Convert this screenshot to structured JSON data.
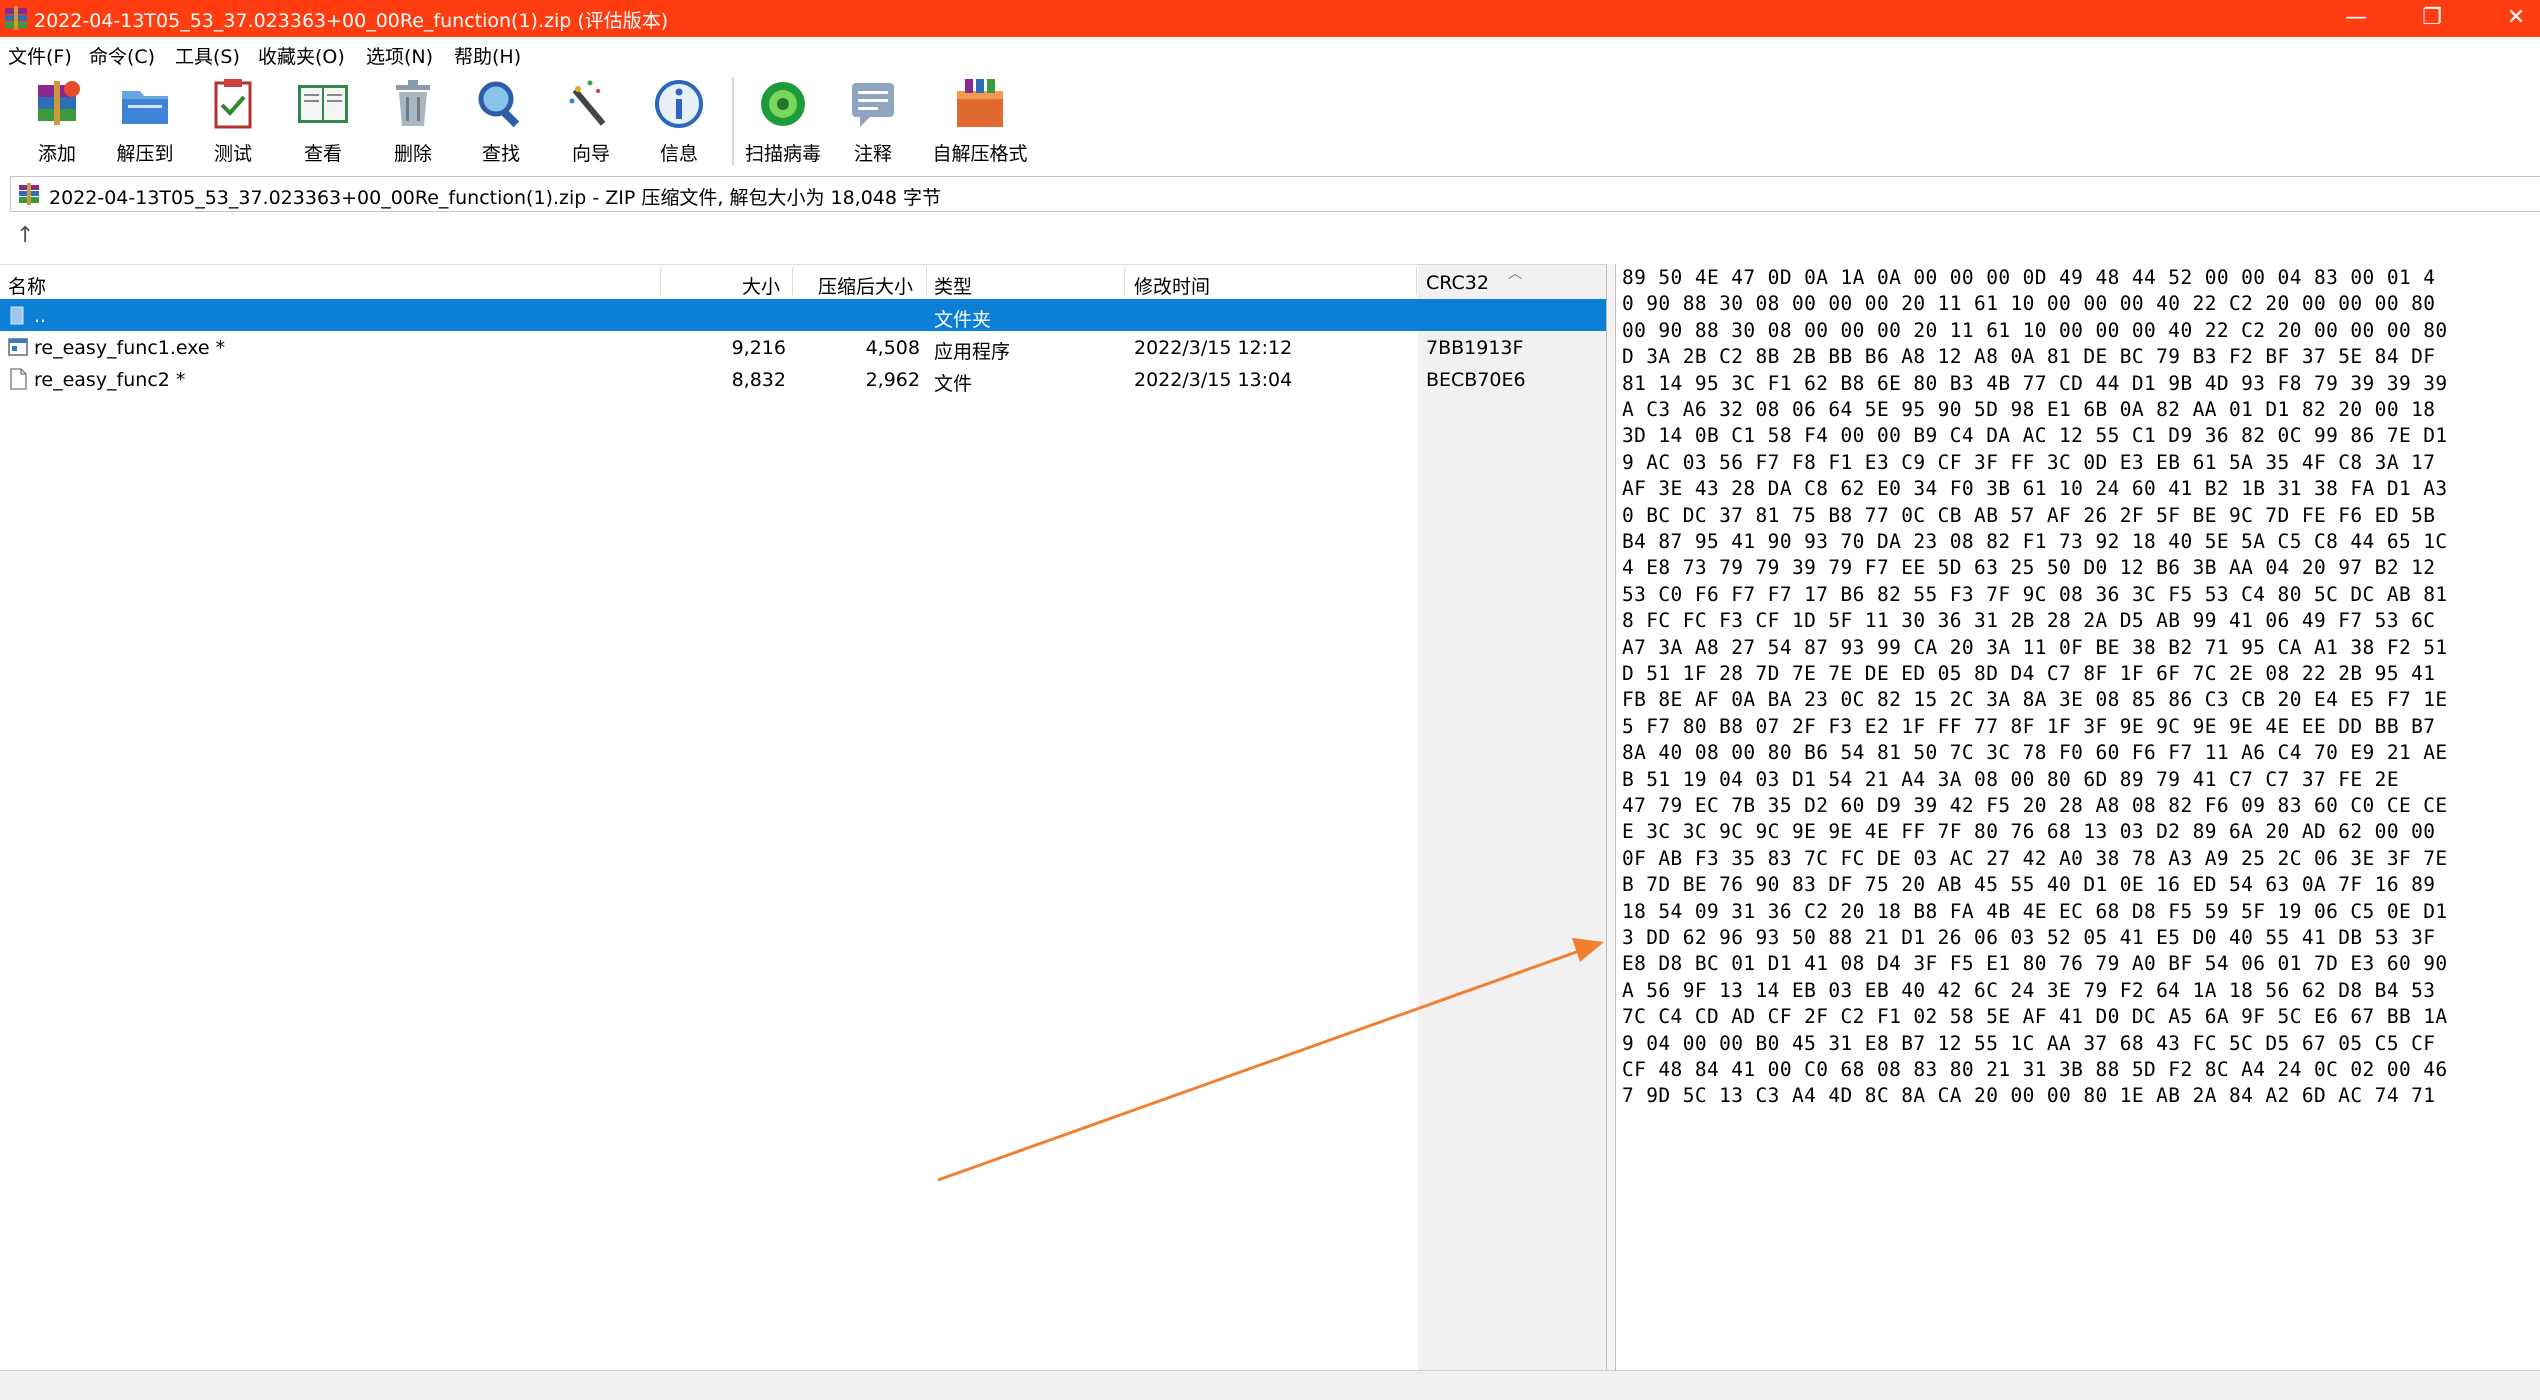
{
  "window": {
    "title": "2022-04-13T05_53_37.023363+00_00Re_function(1).zip (评估版本)",
    "minimize_glyph": "—",
    "maximize_glyph": "❐",
    "close_glyph": "✕"
  },
  "menu": [
    "文件(F)",
    "命令(C)",
    "工具(S)",
    "收藏夹(O)",
    "选项(N)",
    "帮助(H)"
  ],
  "toolbar": {
    "add": "添加",
    "extract_to": "解压到",
    "test": "测试",
    "view": "查看",
    "delete": "删除",
    "find": "查找",
    "wizard": "向导",
    "info": "信息",
    "virus_scan": "扫描病毒",
    "comment": "注释",
    "sfx": "自解压格式"
  },
  "path": {
    "text": "2022-04-13T05_53_37.023363+00_00Re_function(1).zip - ZIP 压缩文件, 解包大小为 18,048 字节",
    "up_glyph": "↑"
  },
  "columns": {
    "name": "名称",
    "size": "大小",
    "packed": "压缩后大小",
    "type": "类型",
    "modified": "修改时间",
    "crc": "CRC32"
  },
  "rows": [
    {
      "name": "..",
      "size": "",
      "packed": "",
      "type": "文件夹",
      "modified": "",
      "crc": ""
    },
    {
      "name": "re_easy_func1.exe *",
      "size": "9,216",
      "packed": "4,508",
      "type": "应用程序",
      "modified": "2022/3/15 12:12",
      "crc": "7BB1913F"
    },
    {
      "name": "re_easy_func2 *",
      "size": "8,832",
      "packed": "2,962",
      "type": "文件",
      "modified": "2022/3/15 13:04",
      "crc": "BECB70E6"
    }
  ],
  "hex_lines": [
    "89 50 4E 47 0D 0A 1A 0A 00 00 00 0D 49 48 44 52 00 00 04 83 00 01 4",
    "0 90 88 30 08 00 00 00 20 11 61 10 00 00 00 40 22 C2 20 00 00 00 80",
    "00 90 88 30 08 00 00 00 20 11 61 10 00 00 00 40 22 C2 20 00 00 00 80",
    "D 3A 2B C2 8B 2B BB B6 A8 12 A8 0A 81 DE BC 79 B3 F2 BF 37 5E 84 DF",
    "81 14 95 3C F1 62 B8 6E 80 B3 4B 77 CD 44 D1 9B 4D 93 F8 79 39 39 39",
    "A C3 A6 32 08 06 64 5E 95 90 5D 98 E1 6B 0A 82 AA 01 D1 82 20 00 18",
    "3D 14 0B C1 58 F4 00 00 B9 C4 DA AC 12 55 C1 D9 36 82 0C 99 86 7E D1",
    "9 AC 03 56 F7 F8 F1 E3 C9 CF 3F FF 3C 0D E3 EB 61 5A 35 4F C8 3A 17",
    "AF 3E 43 28 DA C8 62 E0 34 F0 3B 61 10 24 60 41 B2 1B 31 38 FA D1 A3",
    "0 BC DC 37 81 75 B8 77 0C CB AB 57 AF 26 2F 5F BE 9C 7D FE F6 ED 5B",
    "B4 87 95 41 90 93 70 DA 23 08 82 F1 73 92 18 40 5E 5A C5 C8 44 65 1C",
    "4 E8 73 79 79 39 79 F7 EE 5D 63 25 50 D0 12 B6 3B AA 04 20 97 B2 12",
    "53 C0 F6 F7 F7 17 B6 82 55 F3 7F 9C 08 36 3C F5 53 C4 80 5C DC AB 81",
    "8 FC FC F3 CF 1D 5F 11 30 36 31 2B 28 2A D5 AB 99 41 06 49 F7 53 6C",
    "A7 3A A8 27 54 87 93 99 CA 20 3A 11 0F BE 38 B2 71 95 CA A1 38 F2 51",
    "D 51 1F 28 7D 7E 7E DE ED 05 8D D4 C7 8F 1F 6F 7C 2E 08 22 2B 95 41",
    "FB 8E AF 0A BA 23 0C 82 15 2C 3A 8A 3E 08 85 86 C3 CB 20 E4 E5 F7 1E",
    "5 F7 80 B8 07 2F F3 E2 1F FF 77 8F 1F 3F 9E 9C 9E 9E 4E EE DD BB B7",
    "8A 40 08 00 80 B6 54 81 50 7C 3C 78 F0 60 F6 F7 11 A6 C4 70 E9 21 AE",
    "B 51 19 04 03 D1 54 21 A4 3A 08 00 80 6D 89 79 41 C7 C7 37 FE 2E",
    "47 79 EC 7B 35 D2 60 D9 39 42 F5 20 28 A8 08 82 F6 09 83 60 C0 CE CE",
    "E 3C 3C 9C 9C 9E 9E 4E FF 7F 80 76 68 13 03 D2 89 6A 20 AD 62 00 00",
    "0F AB F3 35 83 7C FC DE 03 AC 27 42 A0 38 78 A3 A9 25 2C 06 3E 3F 7E",
    "B 7D BE 76 90 83 DF 75 20 AB 45 55 40 D1 0E 16 ED 54 63 0A 7F 16 89",
    "18 54 09 31 36 C2 20 18 B8 FA 4B 4E EC 68 D8 F5 59 5F 19 06 C5 0E D1",
    "3 DD 62 96 93 50 88 21 D1 26 06 03 52 05 41 E5 D0 40 55 41 DB 53 3F",
    "E8 D8 BC 01 D1 41 08 D4 3F F5 E1 80 76 79 A0 BF 54 06 01 7D E3 60 90",
    "A 56 9F 13 14 EB 03 EB 40 42 6C 24 3E 79 F2 64 1A 18 56 62 D8 B4 53",
    "7C C4 CD AD CF 2F C2 F1 02 58 5E AF 41 D0 DC A5 6A 9F 5C E6 67 BB 1A",
    "9 04 00 00 B0 45 31 E8 B7 12 55 1C AA 37 68 43 FC 5C D5 67 05 C5 CF",
    "CF 48 84 41 00 C0 68 08 83 80 21 31 3B 88 5D F2 8C A4 24 0C 02 00 46",
    "7 9D 5C 13 C3 A4 4D 8C 8A CA 20 00 00 80 1E AB 2A 84 A2 6D AC 74 71"
  ],
  "colors": {
    "titlebar": "#ff3d10",
    "selection": "#0a7fd4",
    "arrow": "#f08030"
  }
}
